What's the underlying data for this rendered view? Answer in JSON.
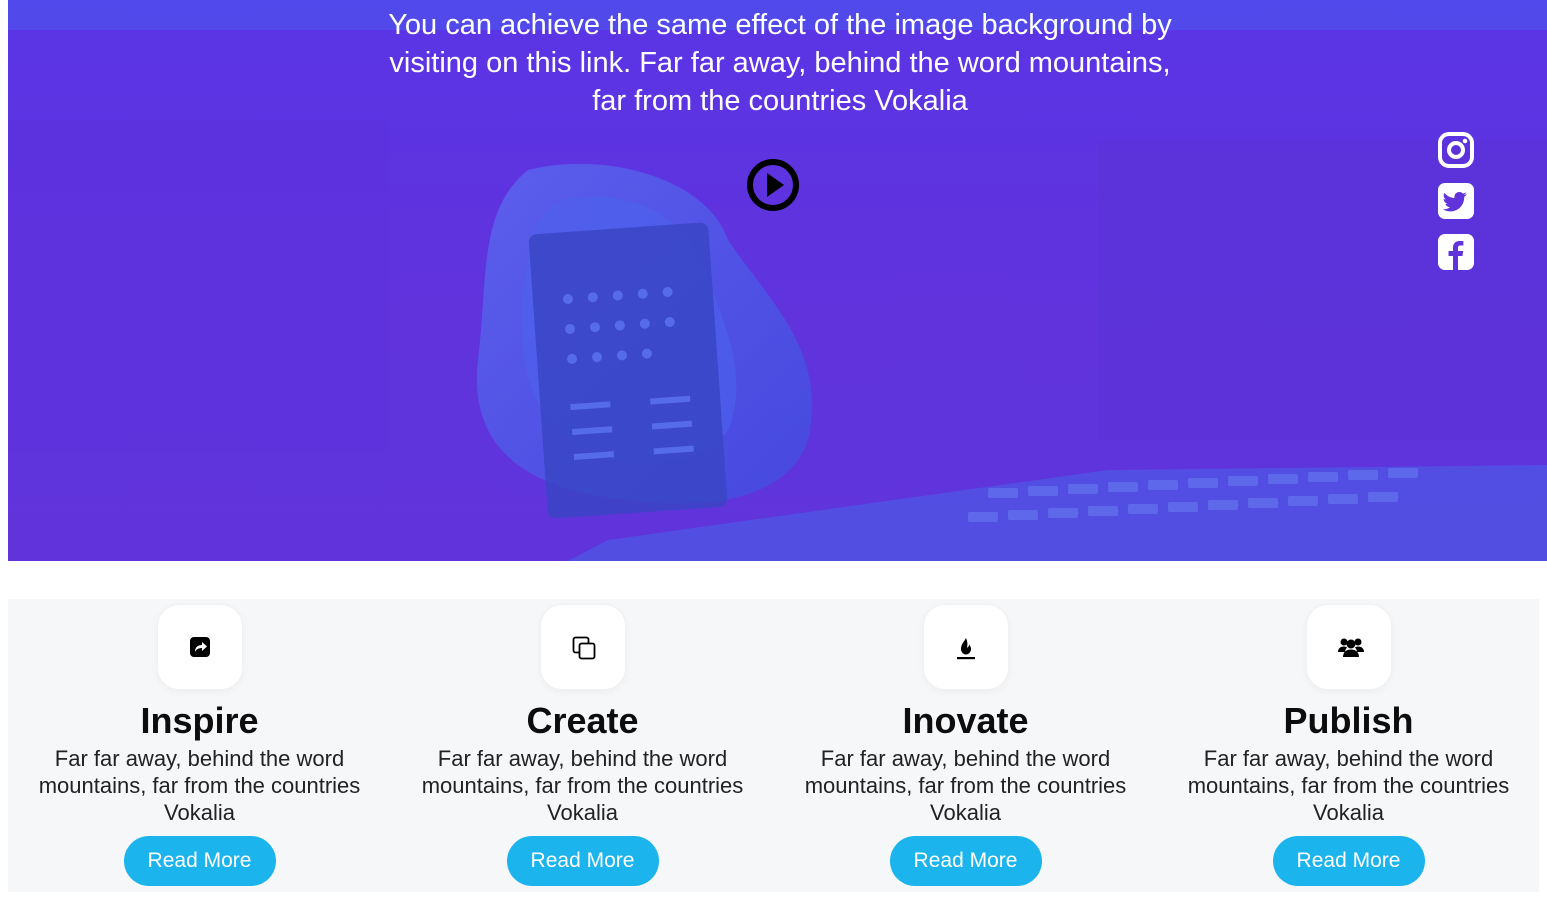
{
  "hero": {
    "text": "You can achieve the same effect of the image background by visiting on this link. Far far away, behind the word mountains, far from the countries Vokalia",
    "play_icon": "play-circle-icon",
    "social": [
      {
        "name": "instagram",
        "icon": "instagram-icon"
      },
      {
        "name": "twitter",
        "icon": "twitter-icon"
      },
      {
        "name": "facebook",
        "icon": "facebook-icon"
      }
    ],
    "overlay_color": "#5f33de"
  },
  "features": [
    {
      "title": "Inspire",
      "description": "Far far away, behind the word mountains, far from the countries Vokalia",
      "button": "Read More",
      "icon": "share-square-icon"
    },
    {
      "title": "Create",
      "description": "Far far away, behind the word mountains, far from the countries Vokalia",
      "button": "Read More",
      "icon": "copy-icon"
    },
    {
      "title": "Inovate",
      "description": "Far far away, behind the word mountains, far from the countries Vokalia",
      "button": "Read More",
      "icon": "fire-burner-icon"
    },
    {
      "title": "Publish",
      "description": "Far far away, behind the word mountains, far from the countries Vokalia",
      "button": "Read More",
      "icon": "users-icon"
    }
  ],
  "colors": {
    "accent": "#1cb4ec",
    "features_background": "#f6f7f9"
  }
}
